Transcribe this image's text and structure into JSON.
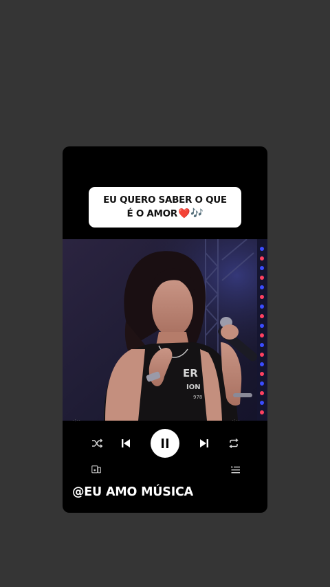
{
  "caption": {
    "line1": "EU QUERO SABER O QUE",
    "line2": "É O AMOR",
    "heart": "❤️",
    "notes": "🎶"
  },
  "player": {
    "elapsed": "-:--",
    "remaining": "-:--",
    "state": "playing"
  },
  "watermark": "@EU AMO MÚSICA",
  "colors": {
    "background": "#353535",
    "card": "#000000",
    "caption_bg": "#ffffff",
    "play_button": "#ffffff"
  },
  "icons": [
    "shuffle-icon",
    "previous-icon",
    "pause-icon",
    "next-icon",
    "repeat-icon",
    "connect-device-icon",
    "queue-icon"
  ]
}
